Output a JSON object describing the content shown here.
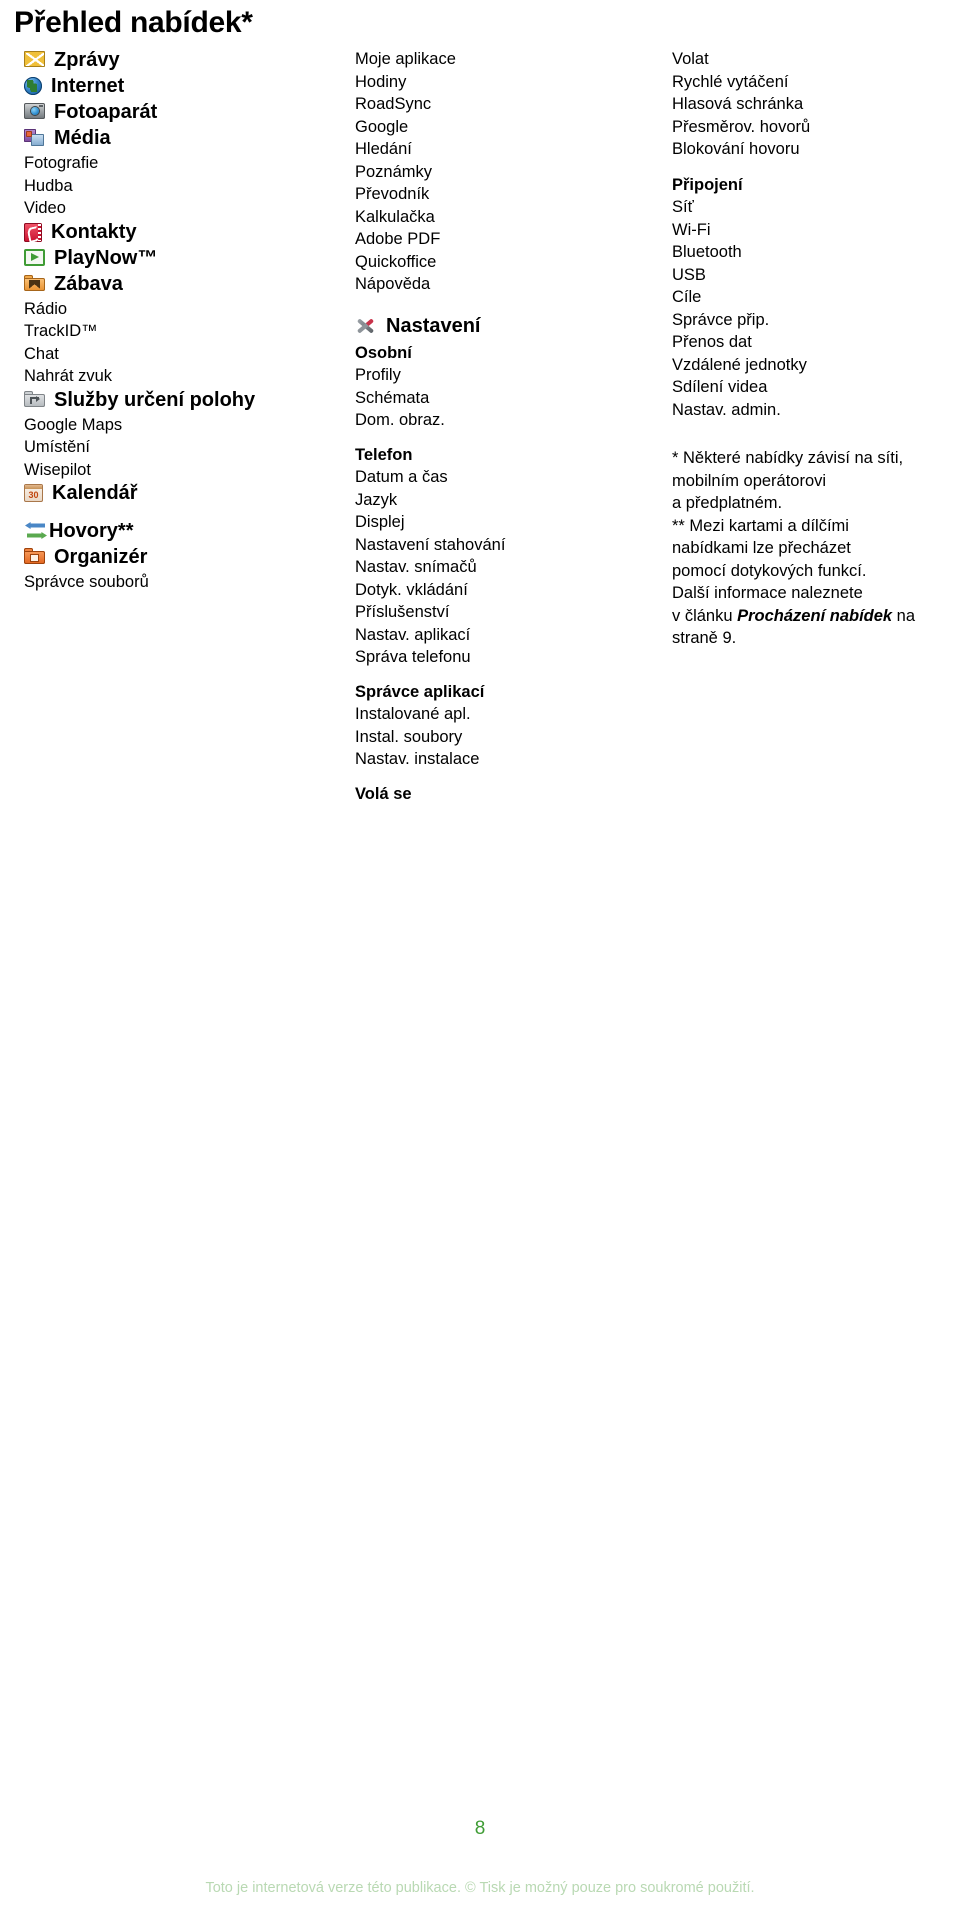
{
  "page": {
    "title": "Přehled nabídek*",
    "number": "8",
    "footer_note": "Toto je internetová verze této publikace. © Tisk je možný pouze pro soukromé použití.",
    "accent_color": "#3f9c35",
    "footer_color": "#b9d9b3"
  },
  "column1": {
    "groups": [
      {
        "icon": "envelope-icon",
        "label": "Zprávy",
        "items": []
      },
      {
        "icon": "globe-icon",
        "label": "Internet",
        "items": []
      },
      {
        "icon": "camera-icon",
        "label": "Fotoaparát",
        "items": []
      },
      {
        "icon": "media-icon",
        "label": "Média",
        "items": [
          "Fotografie",
          "Hudba",
          "Video"
        ]
      },
      {
        "icon": "contacts-book-icon",
        "label": "Kontakty",
        "items": []
      },
      {
        "icon": "play-icon",
        "label": "PlayNow™",
        "items": []
      },
      {
        "icon": "folder-entertainment-icon",
        "label": "Zábava",
        "items": [
          "Rádio",
          "TrackID™",
          "Chat",
          "Nahrát zvuk"
        ]
      },
      {
        "icon": "folder-location-icon",
        "label": "Služby určení polohy",
        "items": [
          "Google Maps",
          "Umístění",
          "Wisepilot"
        ]
      },
      {
        "icon": "calendar-icon",
        "label": "Kalendář",
        "items": []
      },
      {
        "icon": "calls-arrows-icon",
        "label": "Hovory**",
        "items": []
      },
      {
        "icon": "folder-organizer-icon",
        "label": "Organizér",
        "items": [
          "Správce souborů"
        ]
      }
    ]
  },
  "column2": {
    "apps": [
      "Moje aplikace",
      "Hodiny",
      "RoadSync",
      "Google",
      "Hledání",
      "Poznámky",
      "Převodník",
      "Kalkulačka",
      "Adobe PDF",
      "Quickoffice",
      "Nápověda"
    ],
    "settings_heading": {
      "icon": "tools-icon",
      "label": "Nastavení"
    },
    "sections": [
      {
        "heading": "Osobní",
        "items": [
          "Profily",
          "Schémata",
          "Dom. obraz."
        ]
      },
      {
        "heading": "Telefon",
        "items": [
          "Datum a čas",
          "Jazyk",
          "Displej",
          "Nastavení stahování",
          "Nastav. snímačů",
          "Dotyk. vkládání",
          "Příslušenství",
          "Nastav. aplikací",
          "Správa telefonu"
        ]
      },
      {
        "heading": "Správce aplikací",
        "items": [
          "Instalované apl.",
          "Instal. soubory",
          "Nastav. instalace"
        ]
      },
      {
        "heading": "Volá se",
        "items": []
      }
    ]
  },
  "column3": {
    "calls": [
      "Volat",
      "Rychlé vytáčení",
      "Hlasová schránka",
      "Přesměrov. hovorů",
      "Blokování hovoru"
    ],
    "connectivity_heading": "Připojení",
    "connectivity": [
      "Síť",
      "Wi-Fi",
      "Bluetooth",
      "USB",
      "Cíle",
      "Správce přip.",
      "Přenos dat",
      "Vzdálené jednotky",
      "Sdílení videa",
      "Nastav. admin."
    ],
    "footnotes": {
      "line1": "* Některé nabídky závisí na síti,",
      "line2": "mobilním operátorovi",
      "line3": "a předplatném.",
      "line4": "** Mezi kartami a dílčími",
      "line5": "nabídkami lze přecházet",
      "line6": "pomocí dotykových funkcí.",
      "line7": "Další informace naleznete",
      "line8_pre": "v článku ",
      "line8_em": "Procházení nabídek",
      "line8_post": " na",
      "line9": "straně 9."
    }
  }
}
